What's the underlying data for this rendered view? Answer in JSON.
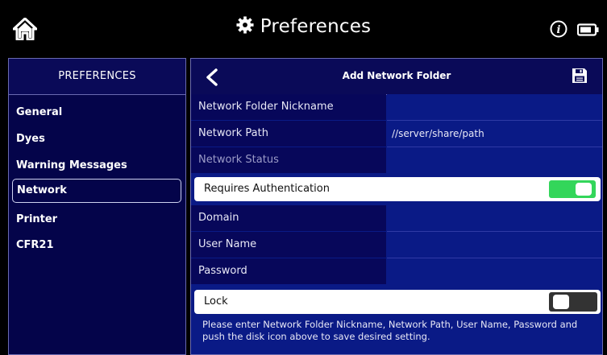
{
  "header": {
    "title": "Preferences",
    "icons": [
      "home-icon",
      "gear-icon",
      "info-icon",
      "battery-icon"
    ]
  },
  "sidebar": {
    "heading": "PREFERENCES",
    "items": [
      {
        "label": "General"
      },
      {
        "label": "Dyes"
      },
      {
        "label": "Warning Messages"
      },
      {
        "label": "Network",
        "active": true
      },
      {
        "label": "Printer"
      },
      {
        "label": "CFR21"
      }
    ]
  },
  "content": {
    "title": "Add Network Folder",
    "fields": [
      {
        "label": "Network Folder Nickname",
        "value": ""
      },
      {
        "label": "Network Path",
        "value": "//server/share/path"
      },
      {
        "label": "Network Status",
        "value": ""
      }
    ],
    "requires_auth": {
      "label": "Requires Authentication",
      "enabled": true
    },
    "auth_fields": [
      {
        "label": "Domain",
        "value": ""
      },
      {
        "label": "User Name",
        "value": ""
      },
      {
        "label": "Password",
        "value": ""
      }
    ],
    "lock": {
      "label": "Lock",
      "enabled": false
    },
    "note": "Please enter Network Folder Nickname, Network Path, User Name, Password and push the disk icon above to save desired setting."
  },
  "colors": {
    "background": "#000000",
    "panel": "#0a1a86",
    "label_cell": "#07075a",
    "toggle_on": "#33d65a"
  }
}
